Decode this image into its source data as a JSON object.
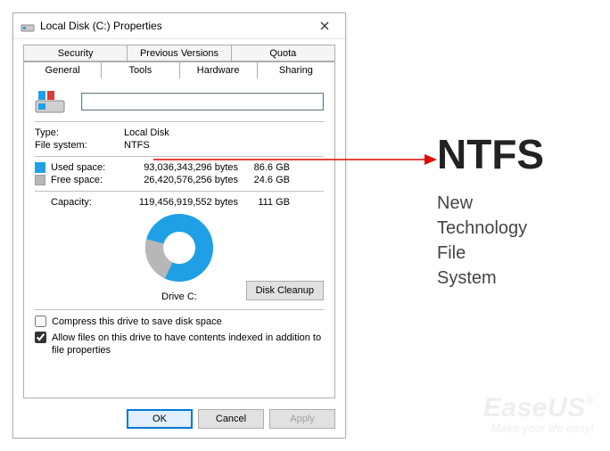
{
  "window": {
    "title": "Local Disk (C:) Properties"
  },
  "tabs_back": [
    "Security",
    "Previous Versions",
    "Quota"
  ],
  "tabs_front": [
    "General",
    "Tools",
    "Hardware",
    "Sharing"
  ],
  "active_tab": "General",
  "drive_name_value": "",
  "type_label": "Type:",
  "type_value": "Local Disk",
  "fs_label": "File system:",
  "fs_value": "NTFS",
  "space": {
    "used_label": "Used space:",
    "used_bytes": "93,036,343,296 bytes",
    "used_human": "86.6 GB",
    "free_label": "Free space:",
    "free_bytes": "26,420,576,256 bytes",
    "free_human": "24.6 GB",
    "capacity_label": "Capacity:",
    "capacity_bytes": "119,456,919,552 bytes",
    "capacity_human": "111 GB"
  },
  "chart_label": "Drive C:",
  "cleanup_button": "Disk Cleanup",
  "check_compress": "Compress this drive to save disk space",
  "check_compress_checked": false,
  "check_index": "Allow files on this drive to have contents indexed in addition to file properties",
  "check_index_checked": true,
  "button_ok": "OK",
  "button_cancel": "Cancel",
  "button_apply": "Apply",
  "callout": {
    "big": "NTFS",
    "line1": "New",
    "line2": "Technology",
    "line3": "File",
    "line4": "System"
  },
  "watermark": {
    "brand": "EaseUS",
    "reg": "®",
    "tag": "Make your life easy!"
  },
  "colors": {
    "used": "#1fa0e6",
    "free": "#b7b7b7",
    "arrow": "#e10600"
  },
  "chart_data": {
    "type": "pie",
    "title": "Drive C:",
    "series": [
      {
        "name": "Used space",
        "value": 93036343296,
        "value_human": "86.6 GB",
        "color": "#1fa0e6"
      },
      {
        "name": "Free space",
        "value": 26420576256,
        "value_human": "24.6 GB",
        "color": "#b7b7b7"
      }
    ],
    "total": {
      "name": "Capacity",
      "value": 119456919552,
      "value_human": "111 GB"
    }
  }
}
